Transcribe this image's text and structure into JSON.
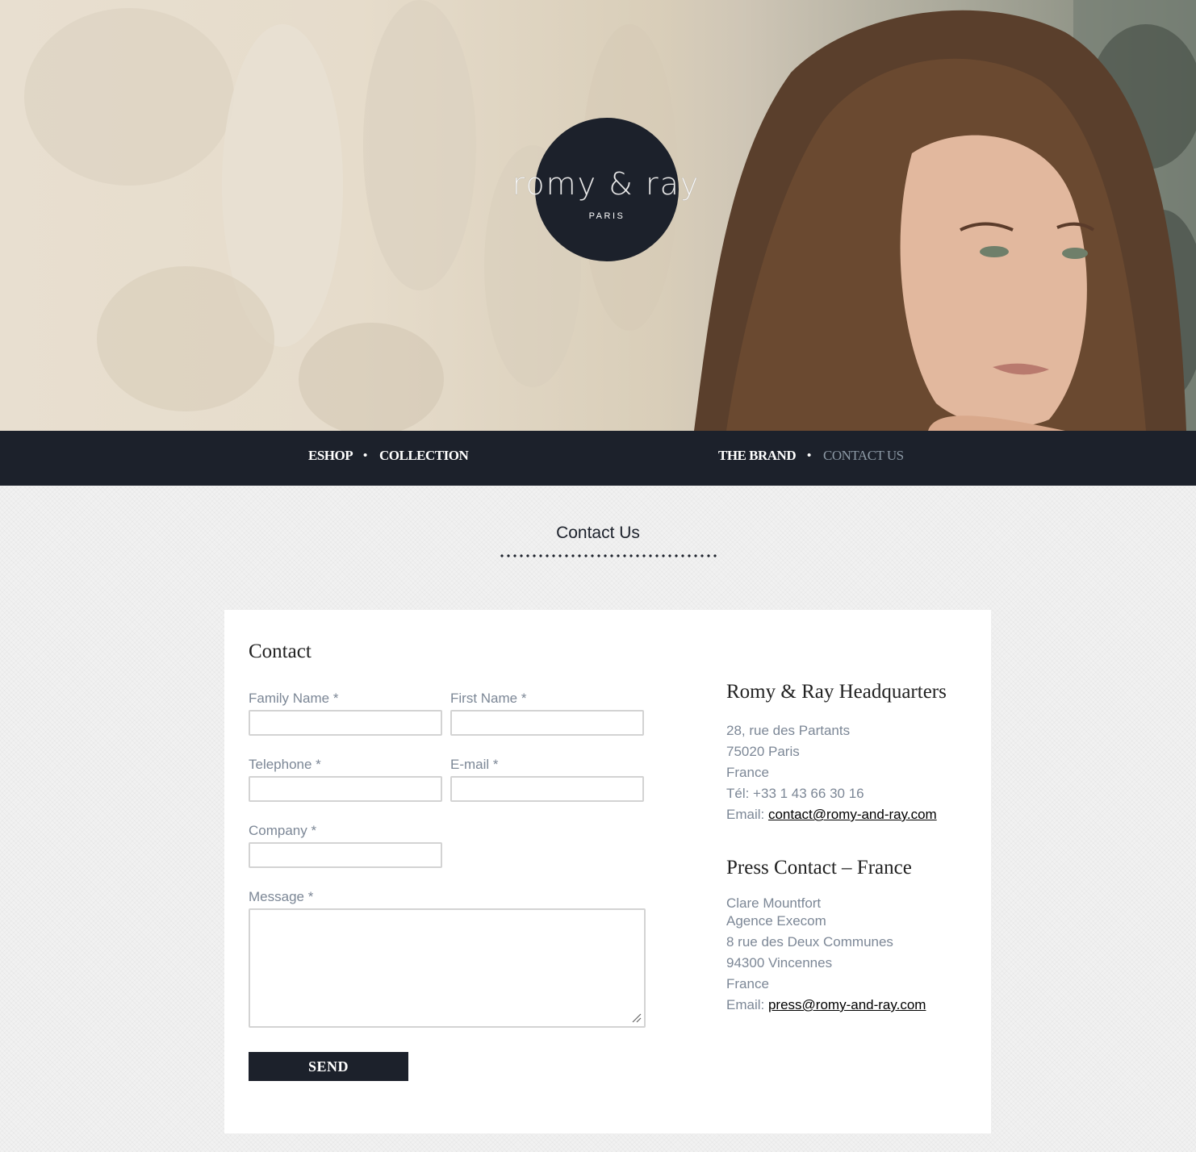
{
  "logo": {
    "name": "romy & ray",
    "city": "PARIS"
  },
  "nav": {
    "left": [
      {
        "label": "ESHOP"
      },
      {
        "label": "COLLECTION"
      }
    ],
    "right": [
      {
        "label": "THE BRAND"
      },
      {
        "label": "CONTACT US",
        "active": true
      }
    ],
    "separator": "•"
  },
  "page": {
    "title": "Contact Us"
  },
  "form": {
    "heading": "Contact",
    "family_name_label": "Family Name *",
    "first_name_label": "First Name *",
    "telephone_label": "Telephone *",
    "email_label": "E-mail *",
    "company_label": "Company *",
    "message_label": "Message *",
    "family_name_value": "",
    "first_name_value": "",
    "telephone_value": "",
    "email_value": "",
    "company_value": "",
    "message_value": "",
    "send_label": "SEND"
  },
  "headquarters": {
    "heading": "Romy & Ray Headquarters",
    "street": "28, rue des Partants",
    "city": "75020 Paris",
    "country": "France",
    "phone": "Tél: +33 1 43 66 30 16",
    "email_prefix": "Email: ",
    "email": "contact@romy-and-ray.com"
  },
  "press": {
    "heading": "Press Contact – France",
    "name": "Clare Mountfort",
    "agency": "Agence Execom",
    "street": "8 rue des Deux Communes",
    "city": "94300 Vincennes",
    "country": "France",
    "email_prefix": "Email: ",
    "email": "press@romy-and-ray.com"
  },
  "colors": {
    "brand_navy": "#1c212b",
    "label_gray": "#7c8796",
    "active_nav": "#8d9aa6"
  }
}
